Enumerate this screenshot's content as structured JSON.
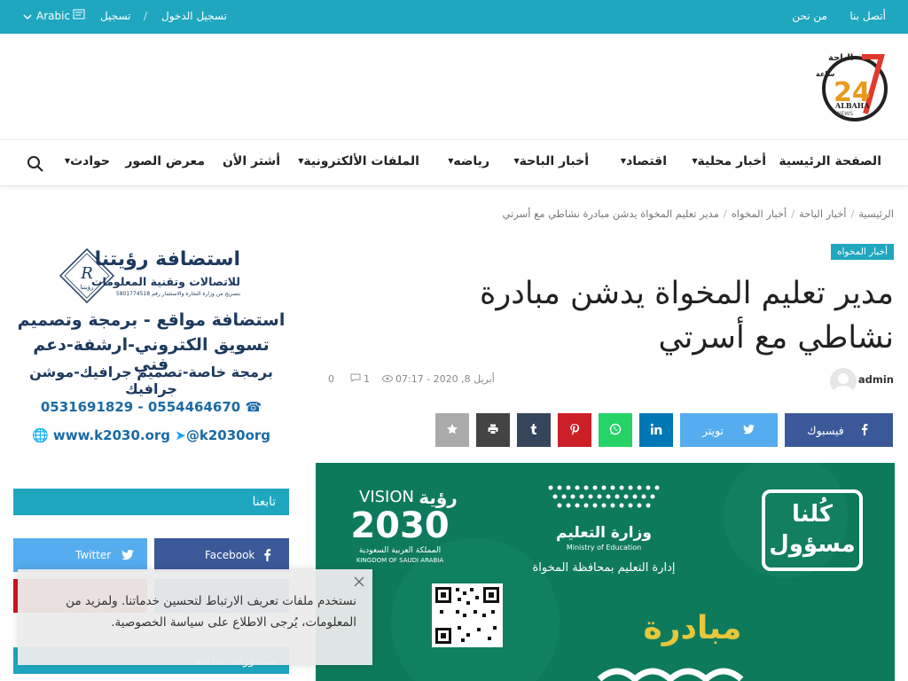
{
  "topbar": {
    "contact": "أتصل بنا",
    "about": "من نحن",
    "login": "تسجيل الدخول",
    "sep": "/",
    "register": "تسجيل",
    "language": "Arabic"
  },
  "logo": {
    "text_top": "الباحة",
    "text_num": "24",
    "text_side": "ساعة",
    "text_brand": "ALBAHA",
    "text_news": "NEWS"
  },
  "nav": {
    "items": [
      {
        "label": "الصفحة الرئيسية",
        "has_menu": false
      },
      {
        "label": "أخبار محلية",
        "has_menu": true
      },
      {
        "label": "اقتصاد",
        "has_menu": true
      },
      {
        "label": "أخبار الباحة",
        "has_menu": true
      },
      {
        "label": "رياضه",
        "has_menu": true
      },
      {
        "label": "الملفات الألكترونية",
        "has_menu": true
      },
      {
        "label": "أشتر الأن",
        "has_menu": false
      },
      {
        "label": "معرض الصور",
        "has_menu": false
      },
      {
        "label": "حوادث",
        "has_menu": true
      }
    ],
    "caret": "▼"
  },
  "breadcrumb": {
    "home": "الرئيسية",
    "c1": "أخبار الباحة",
    "c2": "أخبار المخواه",
    "current": "مدير تعليم المخواة يدشن مبادرة نشاطي مع أسرتي",
    "sep": "/"
  },
  "article": {
    "tag": "أخبار المخواه",
    "title": "مدير تعليم المخواة يدشن مبادرة نشاطي مع أسرتي",
    "author": "admin",
    "date": "أبريل 8, 2020 - 07:17",
    "views": "1",
    "comments": "0"
  },
  "share": {
    "facebook": "فيسبوك",
    "twitter": "تويتر"
  },
  "featured": {
    "slogan_top": "كُلنا",
    "slogan_bottom": "مسؤول",
    "ministry_ar": "وزارة التعليم",
    "ministry_en": "Ministry of Education",
    "department": "إدارة التعليم بمحافظة المخواة",
    "vision_en": "VISION",
    "vision_ar": "رؤية",
    "vision_year": "2030",
    "kingdom_ar": "المملكة العربية السعودية",
    "kingdom_en": "KINGDOM OF SAUDI ARABIA",
    "initiative": "مبادرة"
  },
  "sidebar_ad": {
    "brand": "استضافة رؤيتنا",
    "brand_sub": "للاتصالات وتقنية المعلومات",
    "license": "بتصريح من وزارة التجارة والاستثمار رقم 5801774518",
    "logo_letter": "R",
    "logo_word": "رؤيتنا",
    "line1": "استضافة مواقع - برمجة وتصميم",
    "line2": "تسويق الكتروني-ارشفة-دعم فني",
    "line3": "برمجة خاصة-تصميم جرافيك-موشن جرافيك",
    "phones": "0531691829 - 0554464670",
    "web": "www.k2030.org",
    "twitter": "@k2030org"
  },
  "follow": {
    "heading": "تابعنا",
    "facebook": "Facebook",
    "twitter": "Twitter"
  },
  "popular": {
    "heading": "منشورات شائعة"
  },
  "cookie": {
    "text": "نستخدم ملفات تعريف الارتباط لتحسين خدماتنا. ولمزيد من المعلومات، يُرجى الاطلاع على سياسة الخصوصية."
  },
  "colors": {
    "accent": "#1fa7c0",
    "facebook": "#3b5998",
    "twitter": "#55acee",
    "pinterest": "#cb2027",
    "whatsapp": "#25d366",
    "linkedin": "#0077b5",
    "tumblr": "#35465c",
    "print": "#444444",
    "star": "#aaaaaa",
    "featured_bg": "#0e7a5c"
  }
}
